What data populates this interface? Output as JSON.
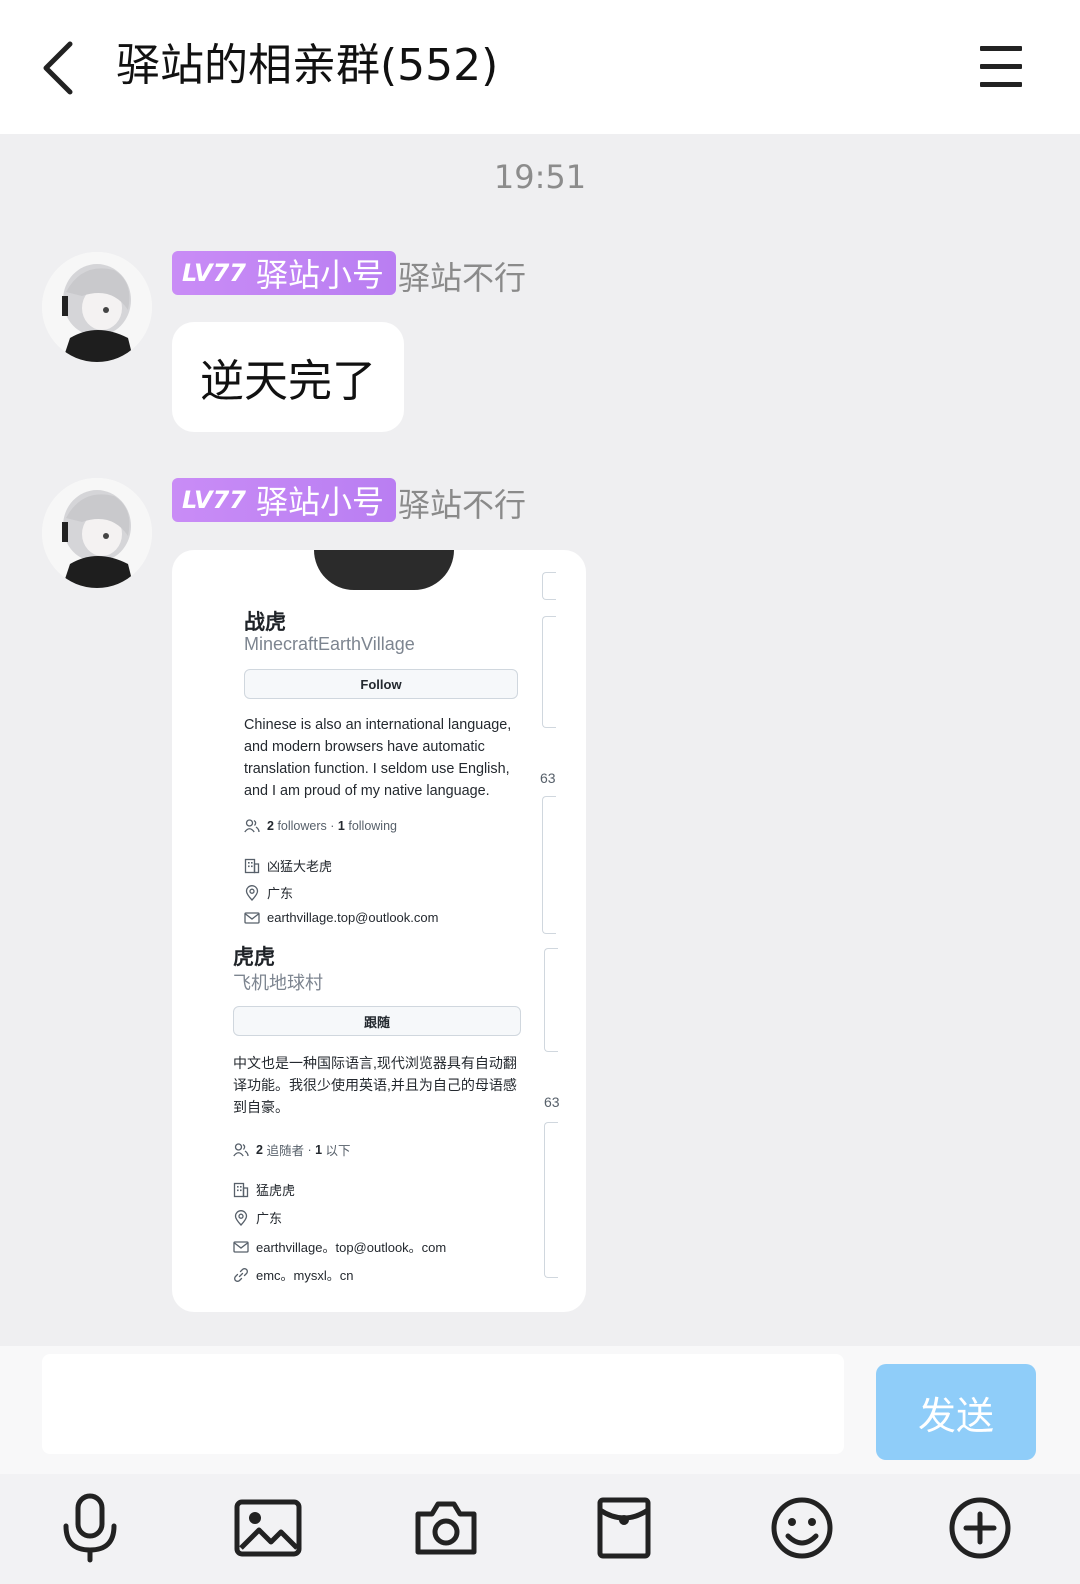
{
  "header": {
    "title": "驿站的相亲群(552)",
    "back_icon": "chevron-left-icon",
    "menu_icon": "hamburger-menu-icon"
  },
  "timestamp": "19:51",
  "messages": [
    {
      "lv": "LV77",
      "member_title": "驿站小号",
      "sender": "驿站不行",
      "text": "逆天完了"
    },
    {
      "lv": "LV77",
      "member_title": "驿站小号",
      "sender": "驿站不行",
      "screenshot": {
        "side_numbers": [
          "63",
          "63"
        ],
        "profile_en": {
          "name": "战虎",
          "username": "MinecraftEarthVillage",
          "button": "Follow",
          "bio": "Chinese is also an international language, and modern browsers have automatic translation function. I seldom use English, and I am proud of my native language.",
          "followers_count": "2",
          "followers_label": "followers",
          "sep": "·",
          "following_count": "1",
          "following_label": "following",
          "company": "凶猛大老虎",
          "location": "广东",
          "email": "earthvillage.top@outlook.com"
        },
        "profile_zh": {
          "name": "虎虎",
          "username": "飞机地球村",
          "button": "跟随",
          "bio": "中文也是一种国际语言,现代浏览器具有自动翻译功能。我很少使用英语,并且为自己的母语感到自豪。",
          "followers_count": "2",
          "followers_label": "追随者",
          "sep": "·",
          "following_count": "1",
          "following_label": "以下",
          "company": "猛虎虎",
          "location": "广东",
          "email": "earthvillage。top@outlook。com",
          "link": "emc。mysxl。cn"
        }
      }
    }
  ],
  "input": {
    "value": "",
    "placeholder": ""
  },
  "send_label": "发送",
  "colors": {
    "lv_badge": "#c98cf6",
    "send_button": "#8fcdf9",
    "chat_background": "#efeff1"
  },
  "toolbar_icons": [
    "microphone-icon",
    "image-icon",
    "camera-icon",
    "red-packet-icon",
    "emoji-icon",
    "plus-icon"
  ]
}
